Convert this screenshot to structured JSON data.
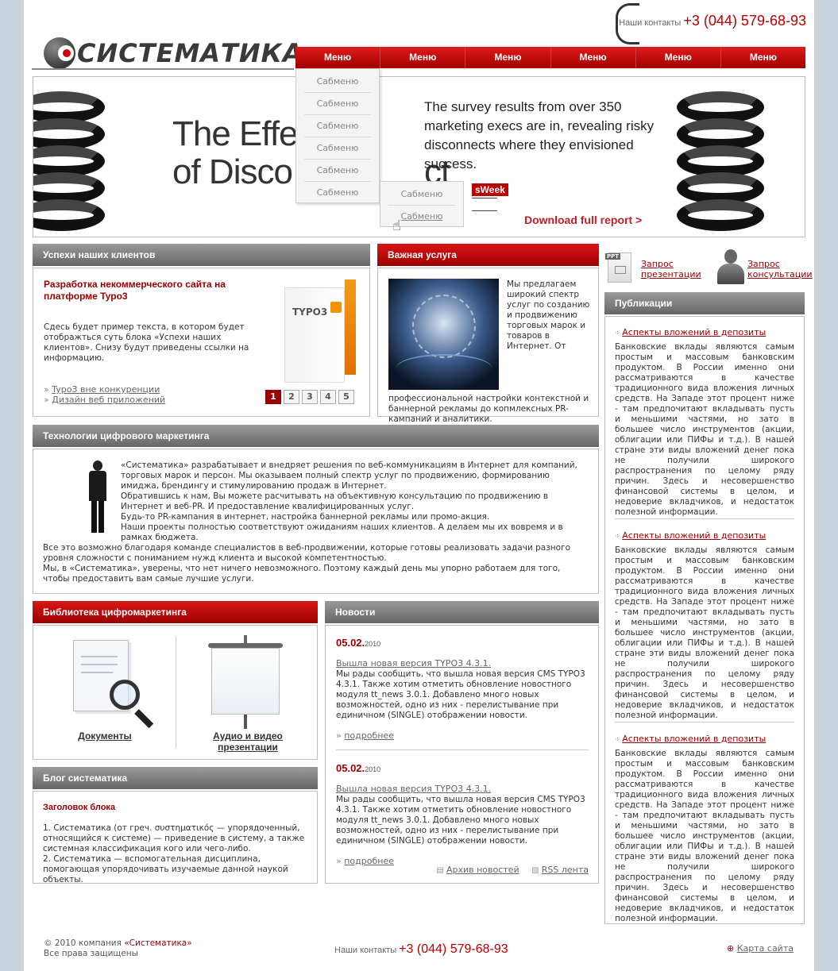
{
  "header": {
    "logo_text": "СИСТЕМАТИКА",
    "contacts_label": "Наши контакты",
    "phone": "+3 (044) 579-68-93"
  },
  "nav": {
    "items": [
      "Меню",
      "Меню",
      "Меню",
      "Меню",
      "Меню",
      "Меню"
    ],
    "submenu": [
      "Сабменю",
      "Сабменю",
      "Сабменю",
      "Сабменю",
      "Сабменю",
      "Сабменю"
    ],
    "submenu2": [
      "Сабменю",
      "Сабменю"
    ]
  },
  "banner": {
    "headline_line1": "The Effe",
    "headline_line2": "of Disco",
    "headline_tail": "ct",
    "survey_text": "The survey results from over 350 marketing execs are in, revealing risky disconnects where they envisioned success.",
    "badge": "sWeek",
    "download_link": "Download full report >"
  },
  "clients": {
    "title": "Успехи наших клиентов",
    "heading": "Разработка некоммерческого сайта на платформе Typo3",
    "text": "Сдесь будет пример текста, в котором будет отображться суть блока «Успехи наших клиентов». Снизу будут приведены ссылки на информацию.",
    "links": [
      "Typo3 вне конкуренции",
      "Дизайн веб приложений"
    ],
    "product_label": "TYPO3",
    "pages": [
      "1",
      "2",
      "3",
      "4",
      "5"
    ]
  },
  "service": {
    "title": "Важная услуга",
    "text": "Мы предлагаем широкий спектр услуг по созданию и продвижению торговых марок и товаров в Интернет. От профессиональной настройки контекстной и баннерной рекламы до копмлексных PR-кампаний и аналитики."
  },
  "requests": {
    "presentation_line1": "Запрос",
    "presentation_line2": "презентации",
    "consultation_line1": "Запрос",
    "consultation_line2": "консультации",
    "ppt_label": "PPT"
  },
  "publications": {
    "title": "Публикации",
    "items": [
      {
        "link": "Аспекты вложений в депозиты",
        "text": "Банковские вклады являются самым простым и массовым банковским продуктом. В России именно они рассматриваются в качестве традиционного вида вложения личных средств. На Западе этот процент ниже - там предпочитают вкладывать пусть и меньшими частями, но зато в большее число инструментов (акции, облигации или ПИФы и т.д.). В нашей стране эти виды вложений денег пока не получили широкого распространения по целому ряду причин. Здесь и несовершенство финансовой системы в целом, и недоверие вкладчиков, и недостаток полезной информации."
      },
      {
        "link": "Аспекты вложений в депозиты",
        "text": "Банковские вклады являются самым простым и массовым банковским продуктом. В России именно они рассматриваются в качестве традиционного вида вложения личных средств. На Западе этот процент ниже - там предпочитают вкладывать пусть и меньшими частями, но зато в большее число инструментов (акции, облигации или ПИФы и т.д.). В нашей стране эти виды вложений денег пока не получили широкого распространения по целому ряду причин. Здесь и несовершенство финансовой системы в целом, и недоверие вкладчиков, и недостаток полезной информации."
      },
      {
        "link": "Аспекты вложений в депозиты",
        "text": "Банковские вклады являются самым простым и массовым банковским продуктом. В России именно они рассматриваются в качестве традиционного вида вложения личных средств. На Западе этот процент ниже - там предпочитают вкладывать пусть и меньшими частями, но зато в большее число инструментов (акции, облигации или ПИФы и т.д.). В нашей стране эти виды вложений денег пока не получили широкого распространения по целому ряду причин. Здесь и несовершенство финансовой системы в целом, и недоверие вкладчиков, и недостаток полезной информации."
      }
    ]
  },
  "technologies": {
    "title": "Технологии цифрового маркетинга",
    "lines": [
      "«Систематика» разрабатывает и внедряет решения по веб-коммуникациям в Интернет для компаний, торговых марок и персон. Мы оказываем полный спектр услуг по продвижению, формированию имиджа, брендингу и стимулированию продаж в Интернет.",
      "Обратившись к нам, Вы можете расчитывать на объективную консультацию по продвижению в Интернет и веб-PR. И предоставление квалифицированных услуг.",
      "Будь-то PR-кампания в интернет, настройка баннерной рекламы или промо-акция.",
      "Наши проекты полностью соответствуют ожиданиям наших клиентов. А делаем мы их вовремя и в рамках бюджета.",
      "Все это возможно благодаря команде специалистов в веб-продвижении, которые готовы реализовать задачи разного уровня сложности с пониманием нужд клиента и высокой компетентностью.",
      "Мы, в «Систематика», уверены, что нет ничего невозможного. Поэтому каждый день мы упорно работаем для того, чтобы предоставить вам самые лучшие услуги."
    ]
  },
  "library": {
    "title": "Библиотека цифромаркетинга",
    "documents": "Документы",
    "av_line1": "Аудио и видео",
    "av_line2": "презентации"
  },
  "news": {
    "title": "Новости",
    "items": [
      {
        "date": "05.02.",
        "year": "2010",
        "headline": "Вышла новая версия TYPO3 4.3.1.",
        "text": "Мы рады сообщить, что вышла новая версия CMS TYPO3 4.3.1. Также хотим отметить обновление новостного модуля tt_news 3.0.1. Добавлено много новых возможностей, одно из них - перелистывание при единичном (SINGLE) отображении новости.",
        "more": "подробнее"
      },
      {
        "date": "05.02.",
        "year": "2010",
        "headline": "Вышла новая версия TYPO3 4.3.1.",
        "text": "Мы рады сообщить, что вышла новая версия CMS TYPO3 4.3.1. Также хотим отметить обновление новостного модуля tt_news 3.0.1. Добавлено много новых возможностей, одно из них - перелистывание при единичном (SINGLE) отображении новости.",
        "more": "подробнее"
      }
    ],
    "archive": "Архив новостей",
    "rss": "RSS лента"
  },
  "blog": {
    "title": "Блог систематика",
    "heading": "Заголовок блока",
    "item1": "1. Систематика (от греч. συστηματικός — упорядоченный, относящийся к системе) — приведение в систему, а также системная классификация кого или чего-либо.",
    "item2": "2. Систематика — вспомогательная дисциплина, помогающая упорядочивать изучаемые данной наукой объекты."
  },
  "footer": {
    "copyright_prefix": "© 2010 компания",
    "company": "«Систематика»",
    "rights": "Все права защищены",
    "contacts_label": "Наши контакты",
    "phone": "+3 (044) 579-68-93",
    "sitemap": "Карта сайта"
  },
  "colors": {
    "accent": "#9c0000",
    "panel_header": "#7a7a7a",
    "background": "#c9d3dd"
  }
}
